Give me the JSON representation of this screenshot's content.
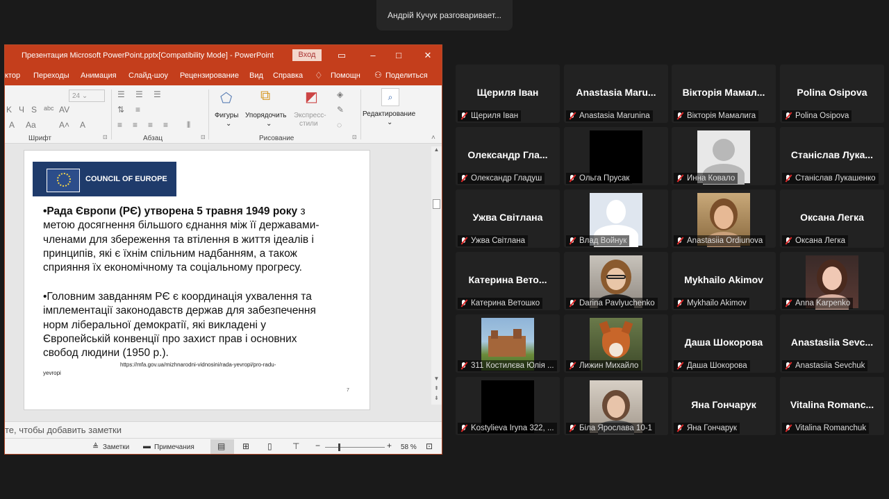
{
  "speaker_banner": "Андрій Кучук разговаривает...",
  "ppt": {
    "title": "Презентация Microsoft PowerPoint.pptx[Compatibility Mode]  -  PowerPoint",
    "login_button": "Вход",
    "menu": [
      "ктор",
      "Переходы",
      "Анимация",
      "Слайд-шоу",
      "Рецензирование",
      "Вид",
      "Справка",
      "Помощн",
      "Поделиться"
    ],
    "ribbon": {
      "font_size": "24",
      "group_font": "Шрифт",
      "group_paragraph": "Абзац",
      "group_drawing": "Рисование",
      "shapes": "Фигуры",
      "arrange": "Упорядочить",
      "quick_styles_1": "Экспресс-",
      "quick_styles_2": "стили",
      "editing": "Редактирование"
    },
    "slide": {
      "logo_text": "COUNCIL OF EUROPE",
      "para1_bold": "•Рада Європи (РЄ) утворена 5 травня 1949 року",
      "para1_rest": " з метою досягнення більшого єднання між її державами-членами для збереження та втілення в життя ідеалів і принципів, які є їхнім спільним надбанням, а також сприяння їх економічному та соціальному прогресу.",
      "para2": "•Головним завданням РЄ є координація ухвалення та імплементації законодавств держав для забезпечення норм ліберальної демократії, які викладені у Європейській конвенції про захист прав і основних свобод людини (1950 р.).",
      "link_1": "https://mfa.gov.ua/mizhnarodni-vidnosini/rada-yevropi/pro-radu-",
      "link_2": "yevropi",
      "page_num": "7"
    },
    "notes_placeholder": "те, чтобы добавить заметки",
    "status": {
      "notes": "Заметки",
      "comments": "Примечания",
      "zoom": "58 %",
      "zoom_level": 0.58
    }
  },
  "participants": [
    {
      "big": "Щериля Іван",
      "label": "Щериля Іван",
      "video": "none"
    },
    {
      "big": "Anastasia  Maru...",
      "label": "Anastasia Marunina",
      "video": "none"
    },
    {
      "big": "Вікторія  Мамал...",
      "label": "Вікторія Мамалига",
      "video": "none"
    },
    {
      "big": "Polina Osipova",
      "label": "Polina Osipova",
      "video": "none"
    },
    {
      "big": "Олександр  Гла...",
      "label": "Олександр Гладуш",
      "video": "none"
    },
    {
      "big": "",
      "label": "Ольга Прусак",
      "video": "black"
    },
    {
      "big": "",
      "label": "Инна Ковало",
      "video": "avatar-gray"
    },
    {
      "big": "Станіслав  Лука...",
      "label": "Станіслав Лукашенко",
      "video": "none"
    },
    {
      "big": "Ужва Світлана",
      "label": "Ужва Світлана",
      "video": "none"
    },
    {
      "big": "",
      "label": "Влад Войнук",
      "video": "avatar-blue"
    },
    {
      "big": "",
      "label": "Anastasiia Ordiunova",
      "video": "photo-girl-1"
    },
    {
      "big": "Оксана Легка",
      "label": "Оксана Легка",
      "video": "none"
    },
    {
      "big": "Катерина  Вето...",
      "label": "Катерина Ветошко",
      "video": "none"
    },
    {
      "big": "",
      "label": "Darina Pavlyuchenko",
      "video": "photo-girl-glasses"
    },
    {
      "big": "Mykhailo Akimov",
      "label": "Mykhailo Akimov",
      "video": "none"
    },
    {
      "big": "",
      "label": "Anna Karpenko",
      "video": "photo-girl-2"
    },
    {
      "big": "",
      "label": "311 Костилєва Юлія ...",
      "video": "photo-castle"
    },
    {
      "big": "",
      "label": "Лижин Михайло",
      "video": "photo-fox"
    },
    {
      "big": "Даша Шокорова",
      "label": "Даша Шокорова",
      "video": "none"
    },
    {
      "big": "Anastasiia  Sevc...",
      "label": "Anastasiia Sevchuk",
      "video": "none"
    },
    {
      "big": "",
      "label": "Kostylieva Iryna 322, ...",
      "video": "black"
    },
    {
      "big": "",
      "label": "Біла Ярослава 10-1",
      "video": "photo-girl-3"
    },
    {
      "big": "Яна Гончарук",
      "label": "Яна Гончарук",
      "video": "none"
    },
    {
      "big": "Vitalina  Romanc...",
      "label": "Vitalina Romanchuk",
      "video": "none"
    }
  ]
}
